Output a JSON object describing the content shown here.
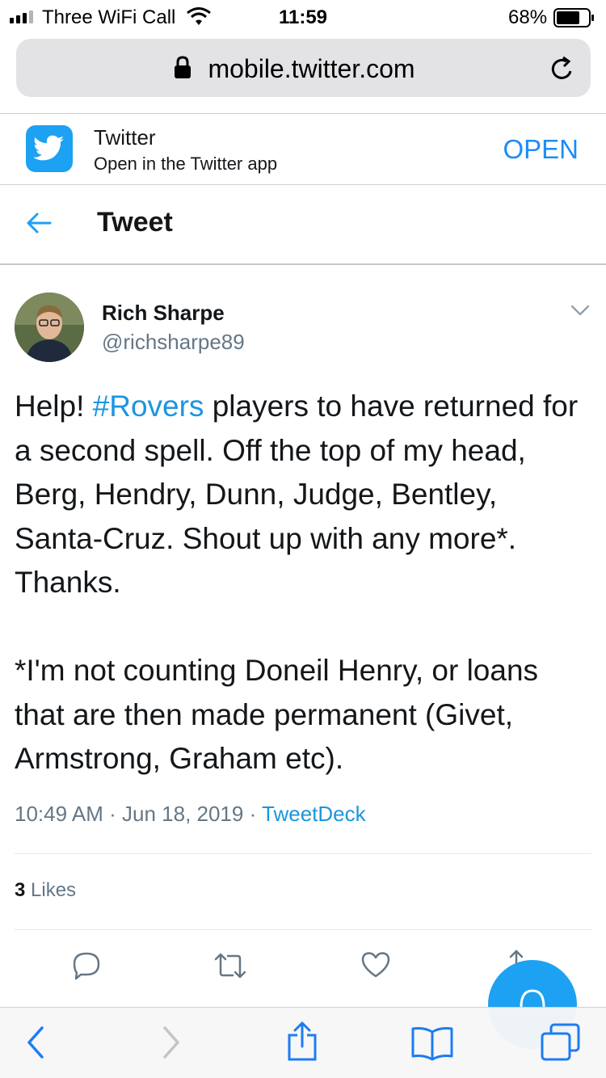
{
  "status_bar": {
    "carrier": "Three WiFi Call",
    "time": "11:59",
    "battery": "68%"
  },
  "browser": {
    "url": "mobile.twitter.com"
  },
  "app_banner": {
    "name": "Twitter",
    "subtitle": "Open in the Twitter app",
    "open_label": "OPEN"
  },
  "header": {
    "title": "Tweet"
  },
  "tweet": {
    "author_name": "Rich Sharpe",
    "author_handle": "@richsharpe89",
    "text_prefix": "Help! ",
    "hashtag": "#Rovers",
    "text_rest": " players to have returned for a second spell. Off the top of my head, Berg, Hendry, Dunn, Judge, Bentley, Santa-Cruz. Shout up with any more*. Thanks.\n\n*I'm not counting Doneil Henry, or loans that are then made permanent (Givet, Armstrong, Graham etc).",
    "time": "10:49 AM",
    "date": "Jun 18, 2019",
    "source": "TweetDeck",
    "separator": "·",
    "likes_count": "3",
    "likes_label": "Likes"
  },
  "colors": {
    "twitter_blue": "#1da1f2",
    "link_blue": "#1b95e0",
    "secondary_text": "#657786"
  }
}
